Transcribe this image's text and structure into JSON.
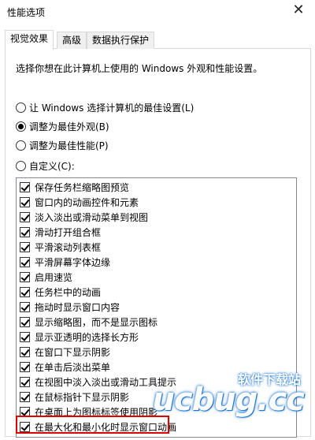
{
  "window": {
    "title": "性能选项",
    "close_glyph": "✕"
  },
  "tabs": [
    {
      "label": "视觉效果",
      "active": true
    },
    {
      "label": "高级",
      "active": false
    },
    {
      "label": "数据执行保护",
      "active": false
    }
  ],
  "description": "选择你想在此计算机上使用的 Windows 外观和性能设置。",
  "radios": [
    {
      "label": "让 Windows 选择计算机的最佳设置(L)",
      "checked": false
    },
    {
      "label": "调整为最佳外观(B)",
      "checked": true
    },
    {
      "label": "调整为最佳性能(P)",
      "checked": false
    },
    {
      "label": "自定义(C):",
      "checked": false
    }
  ],
  "options": [
    {
      "label": "保存任务栏缩略图预览",
      "checked": true
    },
    {
      "label": "窗口内的动画控件和元素",
      "checked": true
    },
    {
      "label": "淡入淡出或滑动菜单到视图",
      "checked": true
    },
    {
      "label": "滑动打开组合框",
      "checked": true
    },
    {
      "label": "平滑滚动列表框",
      "checked": true
    },
    {
      "label": "平滑屏幕字体边缘",
      "checked": true
    },
    {
      "label": "启用速览",
      "checked": true
    },
    {
      "label": "任务栏中的动画",
      "checked": true
    },
    {
      "label": "拖动时显示窗口内容",
      "checked": true
    },
    {
      "label": "显示缩略图，而不是显示图标",
      "checked": true
    },
    {
      "label": "显示亚透明的选择长方形",
      "checked": true
    },
    {
      "label": "在窗口下显示阴影",
      "checked": true
    },
    {
      "label": "在单击后淡出菜单",
      "checked": true
    },
    {
      "label": "在视图中淡入淡出或滑动工具提示",
      "checked": true
    },
    {
      "label": "在鼠标指针下显示阴影",
      "checked": true
    },
    {
      "label": "在桌面上为图标标签使用阴影",
      "checked": true
    },
    {
      "label": "在最大化和最小化时显示窗口动画",
      "checked": true
    }
  ],
  "watermark": {
    "top": "软件下载站",
    "main": "ucbug.cc"
  },
  "colors": {
    "highlight": "#e00000",
    "watermark": "#2b7fd4"
  }
}
